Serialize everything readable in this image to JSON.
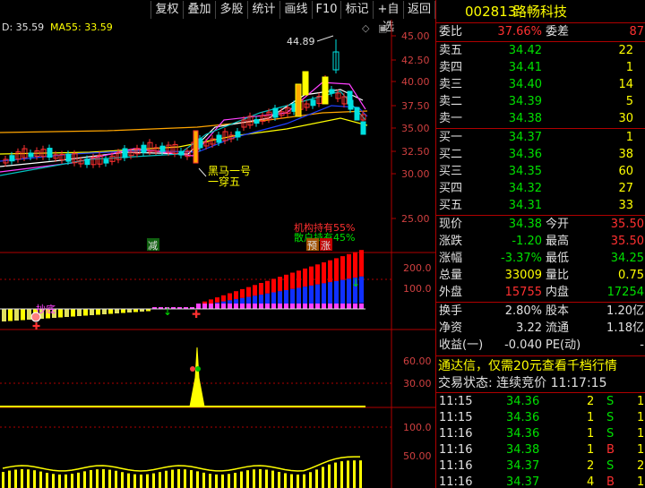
{
  "toolbar": {
    "buttons": [
      "复权",
      "叠加",
      "多股",
      "统计",
      "画线",
      "F10",
      "标记",
      "+自选",
      "返回"
    ],
    "options_icon": "gear-icon"
  },
  "main_chart": {
    "ma_legend_prefix": "D: 35.59",
    "ma55_label": "MA55: 33.59",
    "high_label": "44.89",
    "annot_horse": "黑马一号",
    "annot_pierce": "一穿五",
    "annot_inst": "机构持有55%",
    "annot_retail": "散户持有45%",
    "annot_reduce": "减",
    "annot_pre": "预",
    "annot_rise": "涨",
    "y_ticks": [
      "45.00",
      "42.50",
      "40.00",
      "37.50",
      "35.00",
      "32.50",
      "30.00",
      "25.00"
    ]
  },
  "sub1": {
    "y_ticks": [
      "200.0",
      "100.0"
    ],
    "annot_buy": "抄底"
  },
  "sub2": {
    "y_ticks": [
      "60.00",
      "30.00"
    ]
  },
  "sub3": {
    "y_ticks": [
      "100.0",
      "50.00"
    ]
  },
  "quote": {
    "code": "002813",
    "name": "路畅科技",
    "weibi_label": "委比",
    "weibi_value": "37.66%",
    "weicha_label": "委差",
    "weicha_value": "87",
    "asks": [
      {
        "label": "卖五",
        "price": "34.42",
        "vol": "22"
      },
      {
        "label": "卖四",
        "price": "34.41",
        "vol": "1"
      },
      {
        "label": "卖三",
        "price": "34.40",
        "vol": "14"
      },
      {
        "label": "卖二",
        "price": "34.39",
        "vol": "5"
      },
      {
        "label": "卖一",
        "price": "34.38",
        "vol": "30"
      }
    ],
    "bids": [
      {
        "label": "买一",
        "price": "34.37",
        "vol": "1"
      },
      {
        "label": "买二",
        "price": "34.36",
        "vol": "38"
      },
      {
        "label": "买三",
        "price": "34.35",
        "vol": "60"
      },
      {
        "label": "买四",
        "price": "34.32",
        "vol": "27"
      },
      {
        "label": "买五",
        "price": "34.31",
        "vol": "33"
      }
    ],
    "stats": [
      {
        "l1": "现价",
        "v1": "34.38",
        "c1": "green",
        "l2": "今开",
        "v2": "35.50",
        "c2": "red"
      },
      {
        "l1": "涨跌",
        "v1": "-1.20",
        "c1": "green",
        "l2": "最高",
        "v2": "35.50",
        "c2": "red"
      },
      {
        "l1": "涨幅",
        "v1": "-3.37%",
        "c1": "green",
        "l2": "最低",
        "v2": "34.25",
        "c2": "green"
      },
      {
        "l1": "总量",
        "v1": "33009",
        "c1": "yellow",
        "l2": "量比",
        "v2": "0.75",
        "c2": "yellow"
      },
      {
        "l1": "外盘",
        "v1": "15755",
        "c1": "red",
        "l2": "内盘",
        "v2": "17254",
        "c2": "green"
      }
    ],
    "stats2": [
      {
        "l1": "换手",
        "v1": "2.80%",
        "l2": "股本",
        "v2": "1.20亿"
      },
      {
        "l1": "净资",
        "v1": "3.22",
        "l2": "流通",
        "v2": "1.18亿"
      },
      {
        "l1": "收益(一)",
        "v1": "-0.040",
        "l2": "PE(动)",
        "v2": "-"
      }
    ],
    "promo": "通达信，仅需20元查看千档行情",
    "trade_status": "交易状态: 连续竞价 11:17:15",
    "ticks": [
      {
        "t": "11:15",
        "p": "34.36",
        "v": "2",
        "s": "S",
        "n": "1"
      },
      {
        "t": "11:15",
        "p": "34.36",
        "v": "1",
        "s": "S",
        "n": "1"
      },
      {
        "t": "11:16",
        "p": "34.36",
        "v": "1",
        "s": "S",
        "n": "1"
      },
      {
        "t": "11:16",
        "p": "34.38",
        "v": "1",
        "s": "B",
        "n": "1"
      },
      {
        "t": "11:16",
        "p": "34.37",
        "v": "2",
        "s": "S",
        "n": "2"
      },
      {
        "t": "11:16",
        "p": "34.37",
        "v": "4",
        "s": "B",
        "n": "1"
      }
    ]
  },
  "colors": {
    "up": "#ff3030",
    "down": "#00e000",
    "accent": "#ffff00",
    "border": "#b00000"
  }
}
